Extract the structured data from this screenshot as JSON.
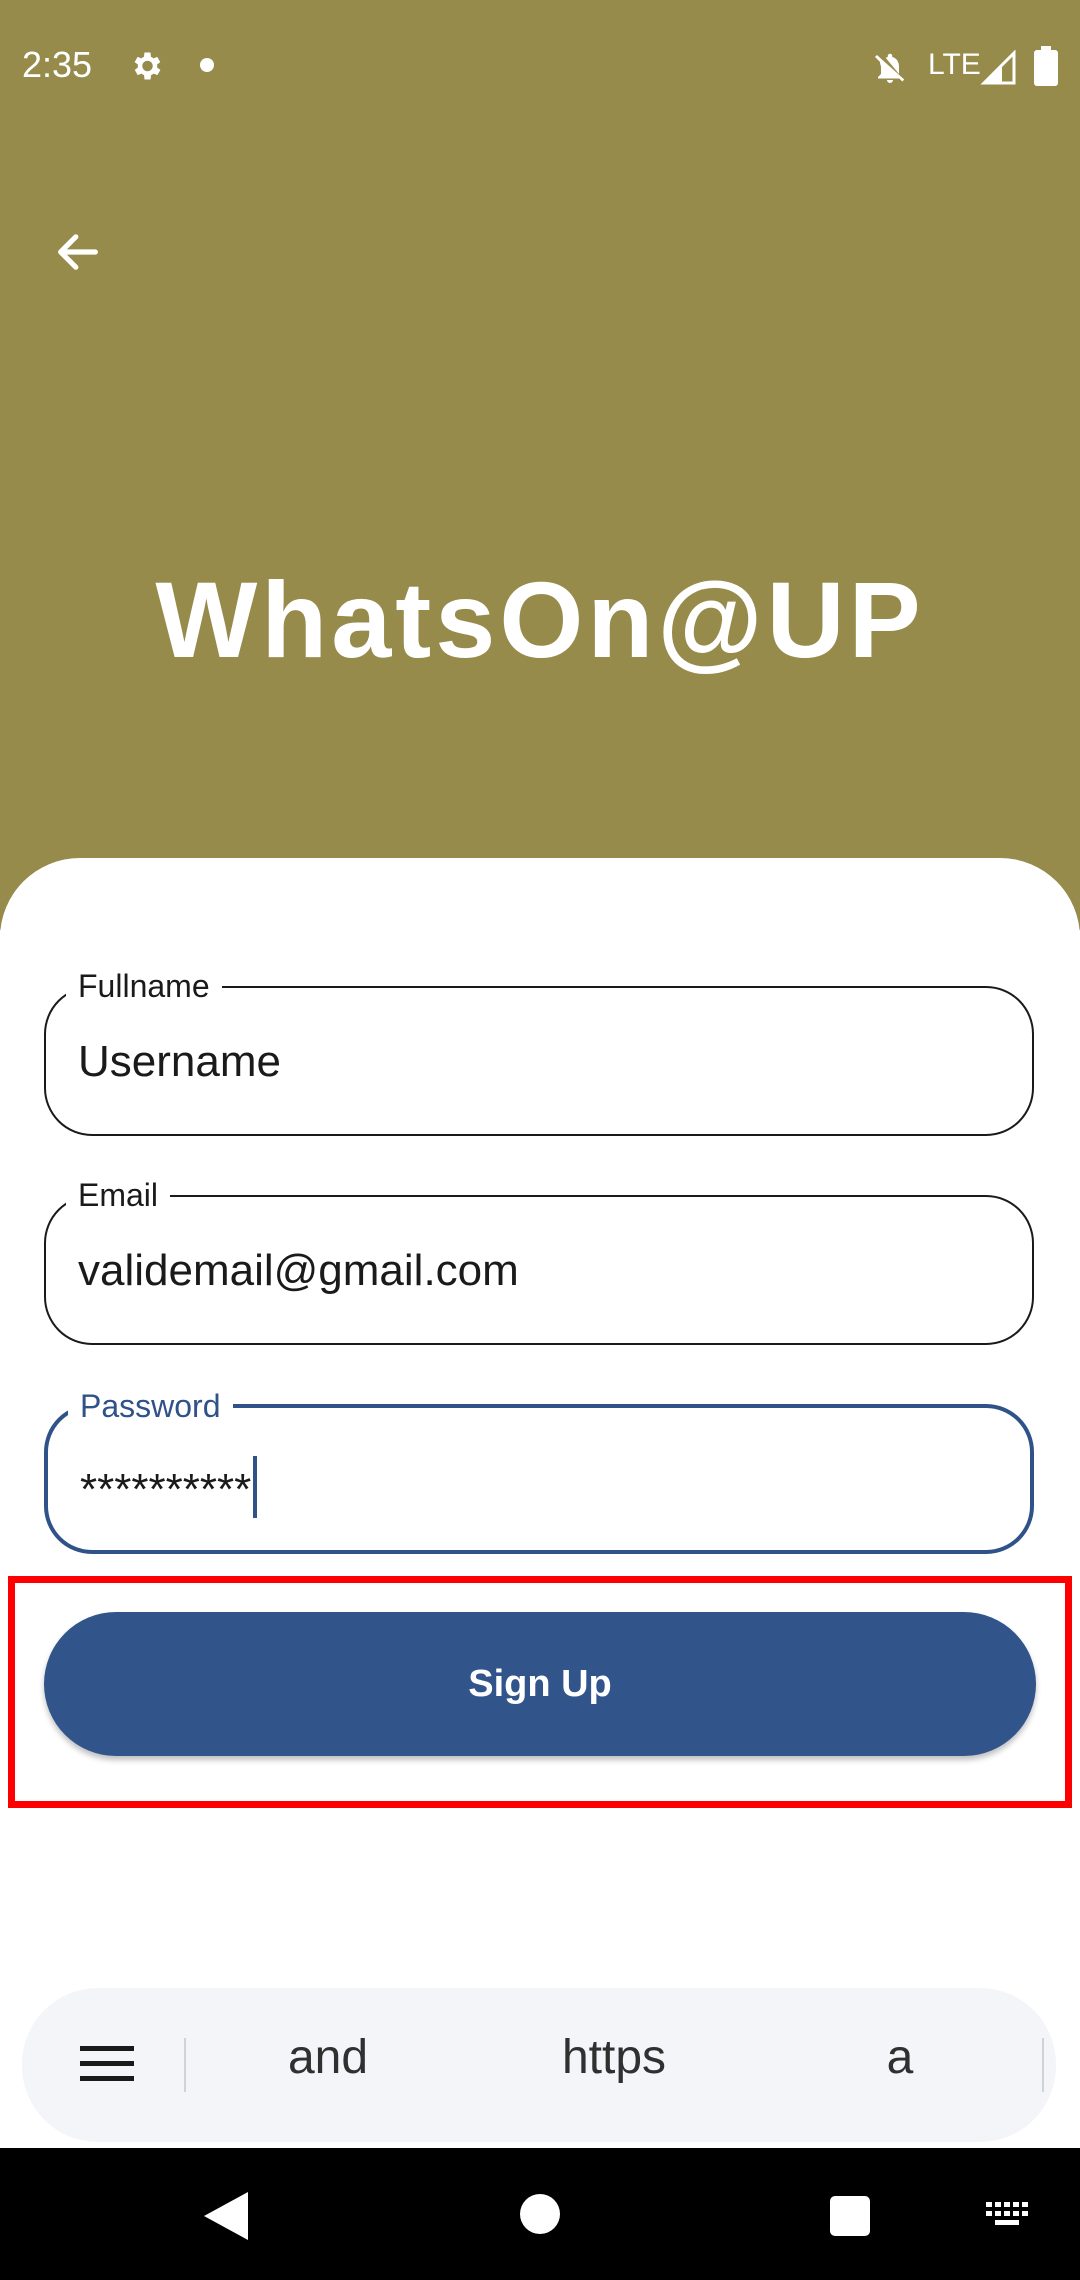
{
  "status_bar": {
    "time": "2:35",
    "network": "LTE"
  },
  "header": {
    "title": "WhatsOn@UP",
    "background_color": "#968b4b"
  },
  "form": {
    "fullname": {
      "label": "Fullname",
      "value": "Username"
    },
    "email": {
      "label": "Email",
      "value": "validemail@gmail.com"
    },
    "password": {
      "label": "Password",
      "value": "**********"
    },
    "submit_label": "Sign Up",
    "accent_color": "#31548a"
  },
  "keyboard": {
    "suggestions": [
      "and",
      "https",
      "a"
    ]
  },
  "icons": {
    "status": [
      "gear-icon",
      "notifications-off-icon",
      "signal-icon",
      "battery-icon"
    ],
    "header": [
      "arrow-left-icon"
    ],
    "keyboard": [
      "menu-icon"
    ],
    "nav": [
      "nav-back-icon",
      "nav-home-icon",
      "nav-recents-icon",
      "keyboard-icon"
    ]
  }
}
